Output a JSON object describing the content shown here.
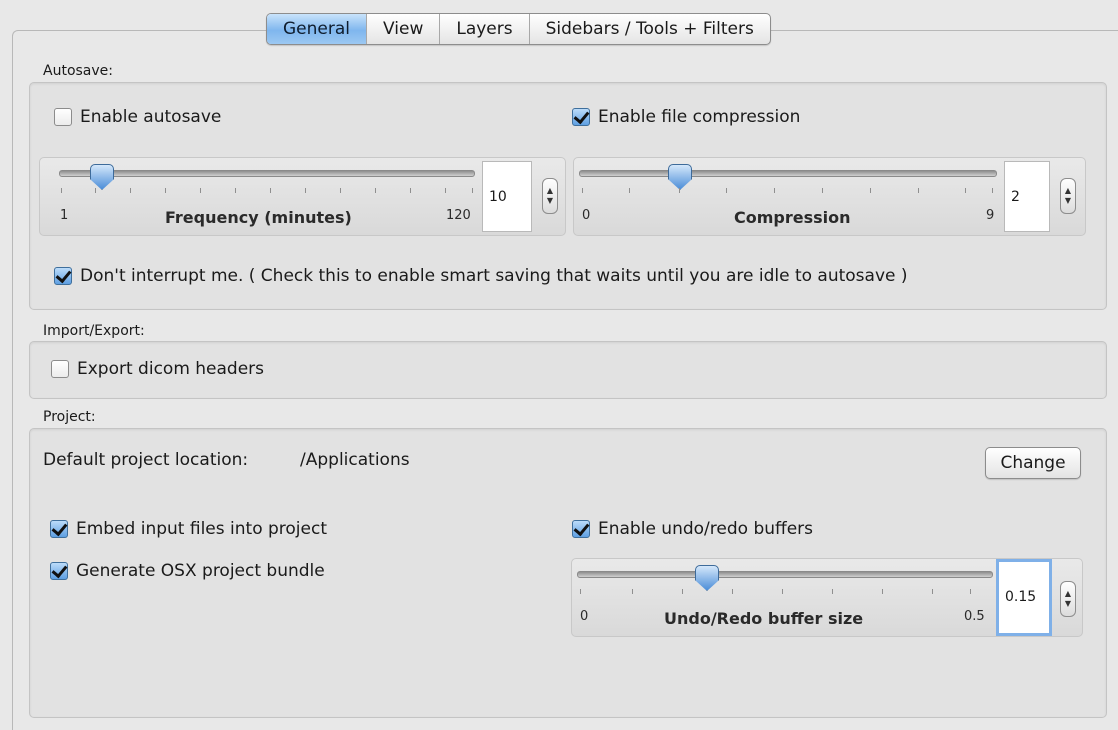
{
  "tabs": [
    {
      "label": "General",
      "active": true
    },
    {
      "label": "View",
      "active": false
    },
    {
      "label": "Layers",
      "active": false
    },
    {
      "label": "Sidebars / Tools + Filters",
      "active": false
    }
  ],
  "autosave": {
    "section_label": "Autosave:",
    "enable_autosave": {
      "label": "Enable autosave",
      "checked": false
    },
    "enable_compression": {
      "label": "Enable file compression",
      "checked": true
    },
    "frequency_slider": {
      "title": "Frequency (minutes)",
      "min": "1",
      "max": "120",
      "value": "10"
    },
    "compression_slider": {
      "title": "Compression",
      "min": "0",
      "max": "9",
      "value": "2"
    },
    "dont_interrupt": {
      "label": "Don't interrupt me. ( Check this to enable smart saving that waits until you are idle to autosave )",
      "checked": true
    }
  },
  "import_export": {
    "section_label": "Import/Export:",
    "export_dicom": {
      "label": "Export dicom headers",
      "checked": false
    }
  },
  "project": {
    "section_label": "Project:",
    "default_location_label": "Default project location:",
    "default_location_value": "/Applications",
    "change_button": "Change",
    "embed_input": {
      "label": "Embed input files into project",
      "checked": true
    },
    "generate_bundle": {
      "label": "Generate OSX project bundle",
      "checked": true
    },
    "enable_undo": {
      "label": "Enable undo/redo buffers",
      "checked": true
    },
    "undo_slider": {
      "title": "Undo/Redo buffer size",
      "min": "0",
      "max": "0.5",
      "value": "0.15"
    }
  },
  "icons": {
    "stepper_up": "▲",
    "stepper_down": "▼"
  }
}
